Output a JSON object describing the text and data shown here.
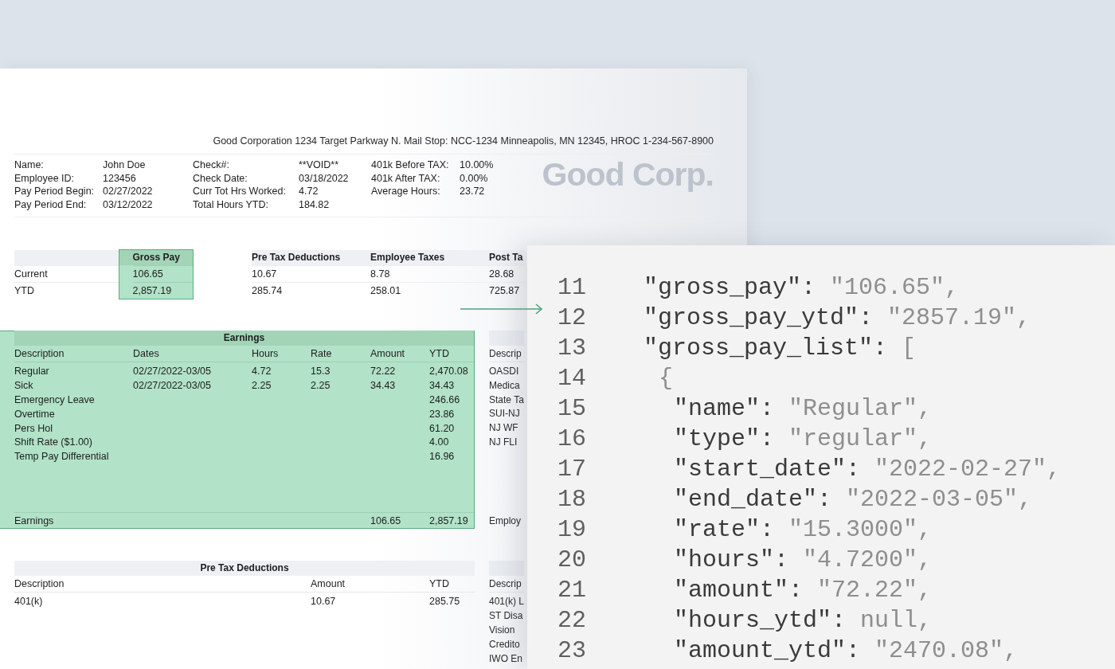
{
  "document": {
    "company_address": "Good Corporation 1234 Target Parkway N. Mail Stop: NCC-1234 Minneapolis, MN 12345, HROC 1-234-567-8900",
    "logo": "Good Corp.",
    "info_columns": [
      [
        {
          "label": "Name:",
          "value": "John Doe"
        },
        {
          "label": "Employee ID:",
          "value": "123456"
        },
        {
          "label": "Pay Period Begin:",
          "value": "02/27/2022"
        },
        {
          "label": "Pay Period End:",
          "value": "03/12/2022"
        }
      ],
      [
        {
          "label": "Check#:",
          "value": "**VOID**"
        },
        {
          "label": "Check Date:",
          "value": "03/18/2022"
        },
        {
          "label": "Curr Tot Hrs Worked:",
          "value": "4.72"
        },
        {
          "label": "Total Hours YTD:",
          "value": "184.82"
        }
      ],
      [
        {
          "label": "401k Before TAX:",
          "value": "10.00%"
        },
        {
          "label": "401k After TAX:",
          "value": "0.00%"
        },
        {
          "label": "Average Hours:",
          "value": "23.72"
        }
      ]
    ],
    "summary": {
      "row_labels": [
        "Current",
        "YTD"
      ],
      "columns": [
        {
          "heading": "Gross Pay",
          "highlighted": true,
          "values": [
            "106.65",
            "2,857.19"
          ]
        },
        {
          "heading": "Pre Tax Deductions",
          "highlighted": false,
          "values": [
            "10.67",
            "285.74"
          ]
        },
        {
          "heading": "Employee Taxes",
          "highlighted": false,
          "values": [
            "8.78",
            "258.01"
          ]
        },
        {
          "heading": "Post Ta",
          "highlighted": false,
          "values": [
            "28.68",
            "725.87"
          ]
        }
      ]
    },
    "earnings": {
      "title": "Earnings",
      "highlighted": true,
      "columns": [
        "Description",
        "Dates",
        "Hours",
        "Rate",
        "Amount",
        "YTD"
      ],
      "rows": [
        {
          "description": "Regular",
          "dates": "02/27/2022-03/05",
          "hours": "4.72",
          "rate": "15.3",
          "amount": "72.22",
          "ytd": "2,470.08"
        },
        {
          "description": "Sick",
          "dates": "02/27/2022-03/05",
          "hours": "2.25",
          "rate": "2.25",
          "amount": "34.43",
          "ytd": "34.43"
        },
        {
          "description": "Emergency Leave",
          "ytd": "246.66"
        },
        {
          "description": "Overtime",
          "ytd": "23.86"
        },
        {
          "description": "Pers Hol",
          "ytd": "61.20"
        },
        {
          "description": "Shift Rate ($1.00)",
          "ytd": "4.00"
        },
        {
          "description": "Temp Pay Differential",
          "ytd": "16.96"
        }
      ],
      "total_row": {
        "description": "Earnings",
        "amount": "106.65",
        "ytd": "2,857.19"
      }
    },
    "table_beside_earnings": {
      "heading": "Descrip",
      "rows": [
        "OASDI",
        "Medica",
        "State Ta",
        "SUI-NJ",
        "NJ WF",
        "NJ FLI"
      ],
      "total_label": "Employ"
    },
    "pre_tax_deductions": {
      "title": "Pre Tax Deductions",
      "highlighted": false,
      "columns": [
        "Description",
        "Amount",
        "YTD"
      ],
      "rows": [
        {
          "description": "401(k)",
          "amount": "10.67",
          "ytd": "285.75"
        }
      ]
    },
    "table_beside_deductions": {
      "heading": "Descrip",
      "rows": [
        "401(k) L",
        "ST Disa",
        "Vision",
        "Credito",
        "IWO En"
      ]
    }
  },
  "code_panel": {
    "lines": [
      {
        "number": "11",
        "key": "\"gross_pay\":",
        "value": "\"106.65\","
      },
      {
        "number": "12",
        "key": "\"gross_pay_ytd\":",
        "value": "\"2857.19\","
      },
      {
        "number": "13",
        "key": "\"gross_pay_list\":",
        "value": "[",
        "children": [
          {
            "number": "14",
            "value": "{",
            "children": [
              {
                "number": "15",
                "key": "\"name\":",
                "value": "\"Regular\","
              },
              {
                "number": "16",
                "key": "\"type\":",
                "value": "\"regular\","
              },
              {
                "number": "17",
                "key": "\"start_date\":",
                "value": "\"2022-02-27\","
              },
              {
                "number": "18",
                "key": "\"end_date\":",
                "value": "\"2022-03-05\","
              },
              {
                "number": "19",
                "key": "\"rate\":",
                "value": "\"15.3000\","
              },
              {
                "number": "20",
                "key": "\"hours\":",
                "value": "\"4.7200\","
              },
              {
                "number": "21",
                "key": "\"amount\":",
                "value": "\"72.22\","
              },
              {
                "number": "22",
                "key": "\"hours_ytd\":",
                "value": "null,"
              },
              {
                "number": "23",
                "key": "\"amount_ytd\":",
                "value": "\"2470.08\","
              }
            ]
          }
        ]
      }
    ]
  }
}
